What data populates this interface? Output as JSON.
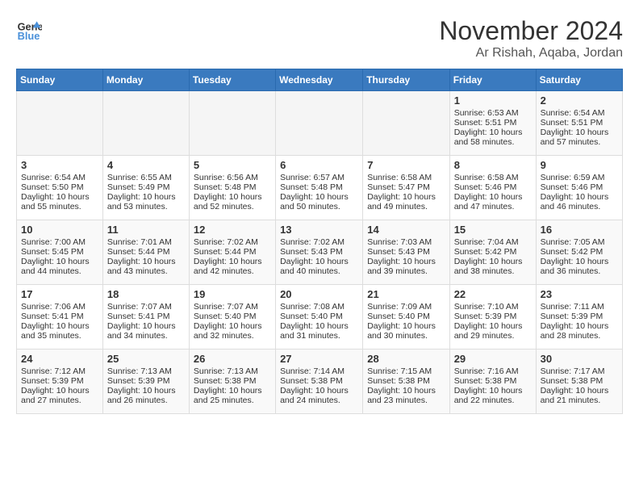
{
  "header": {
    "logo_line1": "General",
    "logo_line2": "Blue",
    "month_year": "November 2024",
    "location": "Ar Rishah, Aqaba, Jordan"
  },
  "weekdays": [
    "Sunday",
    "Monday",
    "Tuesday",
    "Wednesday",
    "Thursday",
    "Friday",
    "Saturday"
  ],
  "weeks": [
    [
      {
        "day": "",
        "info": ""
      },
      {
        "day": "",
        "info": ""
      },
      {
        "day": "",
        "info": ""
      },
      {
        "day": "",
        "info": ""
      },
      {
        "day": "",
        "info": ""
      },
      {
        "day": "1",
        "info": "Sunrise: 6:53 AM\nSunset: 5:51 PM\nDaylight: 10 hours and 58 minutes."
      },
      {
        "day": "2",
        "info": "Sunrise: 6:54 AM\nSunset: 5:51 PM\nDaylight: 10 hours and 57 minutes."
      }
    ],
    [
      {
        "day": "3",
        "info": "Sunrise: 6:54 AM\nSunset: 5:50 PM\nDaylight: 10 hours and 55 minutes."
      },
      {
        "day": "4",
        "info": "Sunrise: 6:55 AM\nSunset: 5:49 PM\nDaylight: 10 hours and 53 minutes."
      },
      {
        "day": "5",
        "info": "Sunrise: 6:56 AM\nSunset: 5:48 PM\nDaylight: 10 hours and 52 minutes."
      },
      {
        "day": "6",
        "info": "Sunrise: 6:57 AM\nSunset: 5:48 PM\nDaylight: 10 hours and 50 minutes."
      },
      {
        "day": "7",
        "info": "Sunrise: 6:58 AM\nSunset: 5:47 PM\nDaylight: 10 hours and 49 minutes."
      },
      {
        "day": "8",
        "info": "Sunrise: 6:58 AM\nSunset: 5:46 PM\nDaylight: 10 hours and 47 minutes."
      },
      {
        "day": "9",
        "info": "Sunrise: 6:59 AM\nSunset: 5:46 PM\nDaylight: 10 hours and 46 minutes."
      }
    ],
    [
      {
        "day": "10",
        "info": "Sunrise: 7:00 AM\nSunset: 5:45 PM\nDaylight: 10 hours and 44 minutes."
      },
      {
        "day": "11",
        "info": "Sunrise: 7:01 AM\nSunset: 5:44 PM\nDaylight: 10 hours and 43 minutes."
      },
      {
        "day": "12",
        "info": "Sunrise: 7:02 AM\nSunset: 5:44 PM\nDaylight: 10 hours and 42 minutes."
      },
      {
        "day": "13",
        "info": "Sunrise: 7:02 AM\nSunset: 5:43 PM\nDaylight: 10 hours and 40 minutes."
      },
      {
        "day": "14",
        "info": "Sunrise: 7:03 AM\nSunset: 5:43 PM\nDaylight: 10 hours and 39 minutes."
      },
      {
        "day": "15",
        "info": "Sunrise: 7:04 AM\nSunset: 5:42 PM\nDaylight: 10 hours and 38 minutes."
      },
      {
        "day": "16",
        "info": "Sunrise: 7:05 AM\nSunset: 5:42 PM\nDaylight: 10 hours and 36 minutes."
      }
    ],
    [
      {
        "day": "17",
        "info": "Sunrise: 7:06 AM\nSunset: 5:41 PM\nDaylight: 10 hours and 35 minutes."
      },
      {
        "day": "18",
        "info": "Sunrise: 7:07 AM\nSunset: 5:41 PM\nDaylight: 10 hours and 34 minutes."
      },
      {
        "day": "19",
        "info": "Sunrise: 7:07 AM\nSunset: 5:40 PM\nDaylight: 10 hours and 32 minutes."
      },
      {
        "day": "20",
        "info": "Sunrise: 7:08 AM\nSunset: 5:40 PM\nDaylight: 10 hours and 31 minutes."
      },
      {
        "day": "21",
        "info": "Sunrise: 7:09 AM\nSunset: 5:40 PM\nDaylight: 10 hours and 30 minutes."
      },
      {
        "day": "22",
        "info": "Sunrise: 7:10 AM\nSunset: 5:39 PM\nDaylight: 10 hours and 29 minutes."
      },
      {
        "day": "23",
        "info": "Sunrise: 7:11 AM\nSunset: 5:39 PM\nDaylight: 10 hours and 28 minutes."
      }
    ],
    [
      {
        "day": "24",
        "info": "Sunrise: 7:12 AM\nSunset: 5:39 PM\nDaylight: 10 hours and 27 minutes."
      },
      {
        "day": "25",
        "info": "Sunrise: 7:13 AM\nSunset: 5:39 PM\nDaylight: 10 hours and 26 minutes."
      },
      {
        "day": "26",
        "info": "Sunrise: 7:13 AM\nSunset: 5:38 PM\nDaylight: 10 hours and 25 minutes."
      },
      {
        "day": "27",
        "info": "Sunrise: 7:14 AM\nSunset: 5:38 PM\nDaylight: 10 hours and 24 minutes."
      },
      {
        "day": "28",
        "info": "Sunrise: 7:15 AM\nSunset: 5:38 PM\nDaylight: 10 hours and 23 minutes."
      },
      {
        "day": "29",
        "info": "Sunrise: 7:16 AM\nSunset: 5:38 PM\nDaylight: 10 hours and 22 minutes."
      },
      {
        "day": "30",
        "info": "Sunrise: 7:17 AM\nSunset: 5:38 PM\nDaylight: 10 hours and 21 minutes."
      }
    ]
  ]
}
